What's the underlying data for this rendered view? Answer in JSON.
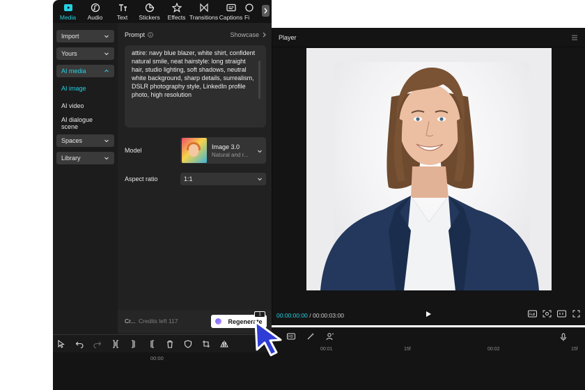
{
  "toolbar": {
    "tabs": [
      {
        "label": "Media",
        "icon": "media-icon"
      },
      {
        "label": "Audio",
        "icon": "audio-icon"
      },
      {
        "label": "Text",
        "icon": "text-icon"
      },
      {
        "label": "Stickers",
        "icon": "stickers-icon"
      },
      {
        "label": "Effects",
        "icon": "effects-icon"
      },
      {
        "label": "Transitions",
        "icon": "transitions-icon"
      },
      {
        "label": "Captions",
        "icon": "captions-icon"
      },
      {
        "label": "Fi",
        "icon": "filters-icon"
      }
    ],
    "active_color": "#25d0e2"
  },
  "leftnav": {
    "items": [
      {
        "label": "Import"
      },
      {
        "label": "Yours"
      },
      {
        "label": "AI media"
      },
      {
        "label": "AI image"
      },
      {
        "label": "AI video"
      },
      {
        "label": "AI dialogue scene"
      },
      {
        "label": "Spaces"
      },
      {
        "label": "Library"
      }
    ]
  },
  "prompt": {
    "title": "Prompt",
    "showcase": "Showcase",
    "text": "attire: navy blue blazer, white shirt, confident natural smile, neat hairstyle: long straight hair, studio lighting, soft shadows, neutral white background, sharp details, surrealism, DSLR photography style, LinkedIn profile photo, high resolution"
  },
  "model": {
    "label": "Model",
    "name": "Image 3.0",
    "sub": "Natural and r..."
  },
  "aspect": {
    "label": "Aspect ratio",
    "value": "1:1"
  },
  "footer": {
    "cr": "Cr...",
    "credits": "Credits left 117",
    "regenerate": "Regenerate",
    "badge": "1"
  },
  "player": {
    "title": "Player",
    "current_time": "00:00:00:00",
    "total_time": "00:00:03:00",
    "full_label": "Full"
  },
  "timeline": {
    "start": "00:00",
    "marks": [
      "00:01",
      "15f",
      "00:02",
      "15f"
    ]
  }
}
